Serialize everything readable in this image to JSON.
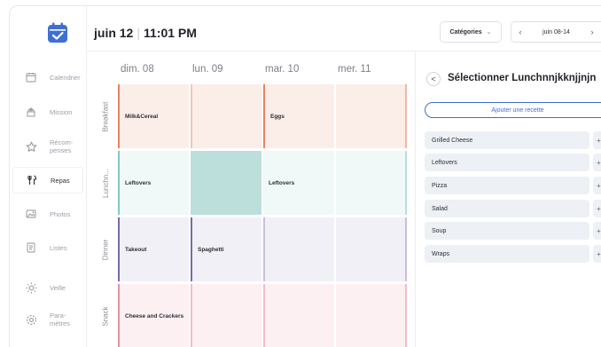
{
  "sidebar": {
    "logo_icon": "calendar-check-icon",
    "items": [
      {
        "label": "Calendrier",
        "icon": "calendar-icon"
      },
      {
        "label": "Mission",
        "icon": "mission-icon"
      },
      {
        "label": "Récom-\npenses",
        "icon": "star-icon"
      },
      {
        "label": "Repas",
        "icon": "fork-knife-icon"
      },
      {
        "label": "Photos",
        "icon": "photo-icon"
      },
      {
        "label": "Listes",
        "icon": "list-icon"
      },
      {
        "label": "Veille",
        "icon": "sun-icon"
      },
      {
        "label": "Para-\nmètres",
        "icon": "gear-icon"
      }
    ],
    "active_index": 3
  },
  "header": {
    "date": "juin 12",
    "time": "11:01 PM",
    "categories_label": "Catégories",
    "week_label": "juin 08-14"
  },
  "days": [
    "dim. 08",
    "lun. 09",
    "mar. 10",
    "mer. 11"
  ],
  "meals": [
    {
      "label": "Breakfast",
      "cells": [
        "Milk&Cereal",
        "",
        "Eggs",
        ""
      ]
    },
    {
      "label": "Lunchn...",
      "cells": [
        "Leftovers",
        "",
        "Leftovers",
        ""
      ]
    },
    {
      "label": "Dinner",
      "cells": [
        "Takeout",
        "Spaghetti",
        "",
        ""
      ]
    },
    {
      "label": "Snack",
      "cells": [
        "Cheese and Crackers",
        "",
        "",
        ""
      ]
    }
  ],
  "panel": {
    "back_symbol": "<",
    "title": "Sélectionner Lunchnnjkknjjnjn",
    "add_recipe_label": "Ajouter une recette",
    "recipes": [
      "Grilled Cheese",
      "Leftovers",
      "Pizza",
      "Salad",
      "Soup",
      "Wraps"
    ],
    "recipe_add_symbol": "+"
  },
  "colors": {
    "accent_blue": "#3f6fd1",
    "breakfast": "#e8845c",
    "lunch": "#84c7c2",
    "dinner": "#7a6aa6",
    "snack": "#e890a1"
  }
}
